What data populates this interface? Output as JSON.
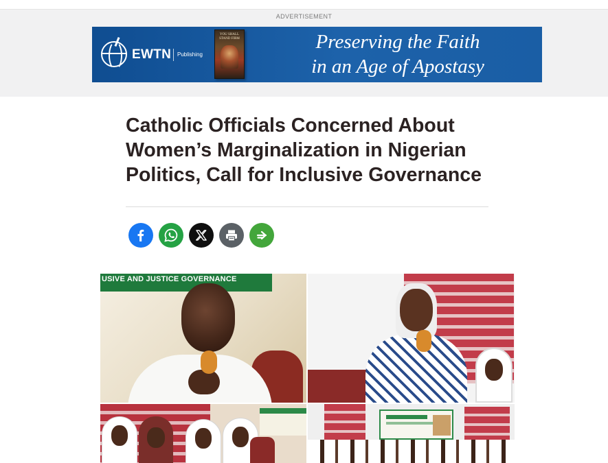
{
  "advertisement": {
    "label": "ADVERTISEMENT",
    "brand": "EWTN",
    "brand_sub": "Publishing",
    "book_title": "YOU SHALL STAND FIRM",
    "headline_line1": "Preserving the Faith",
    "headline_line2": "in an Age of Apostasy",
    "colors": {
      "banner": "#1a5ea5",
      "zone_bg": "#f1f1f2"
    }
  },
  "article": {
    "title_line1": "Catholic Officials Concerned About",
    "title_line2": "Women’s Marginalization in Nigerian",
    "title_line3": "Politics, Call for Inclusive Governance"
  },
  "share": {
    "buttons": [
      {
        "icon": "facebook-icon",
        "color": "#1877f2"
      },
      {
        "icon": "whatsapp-icon",
        "color": "#25a244"
      },
      {
        "icon": "x-icon",
        "color": "#0f0f0f"
      },
      {
        "icon": "print-icon",
        "color": "#5b6166"
      },
      {
        "icon": "share-more-icon",
        "color": "#43a63b"
      }
    ]
  },
  "photo": {
    "banner_text": "USIVE AND JUSTICE GOVERNANCE"
  }
}
